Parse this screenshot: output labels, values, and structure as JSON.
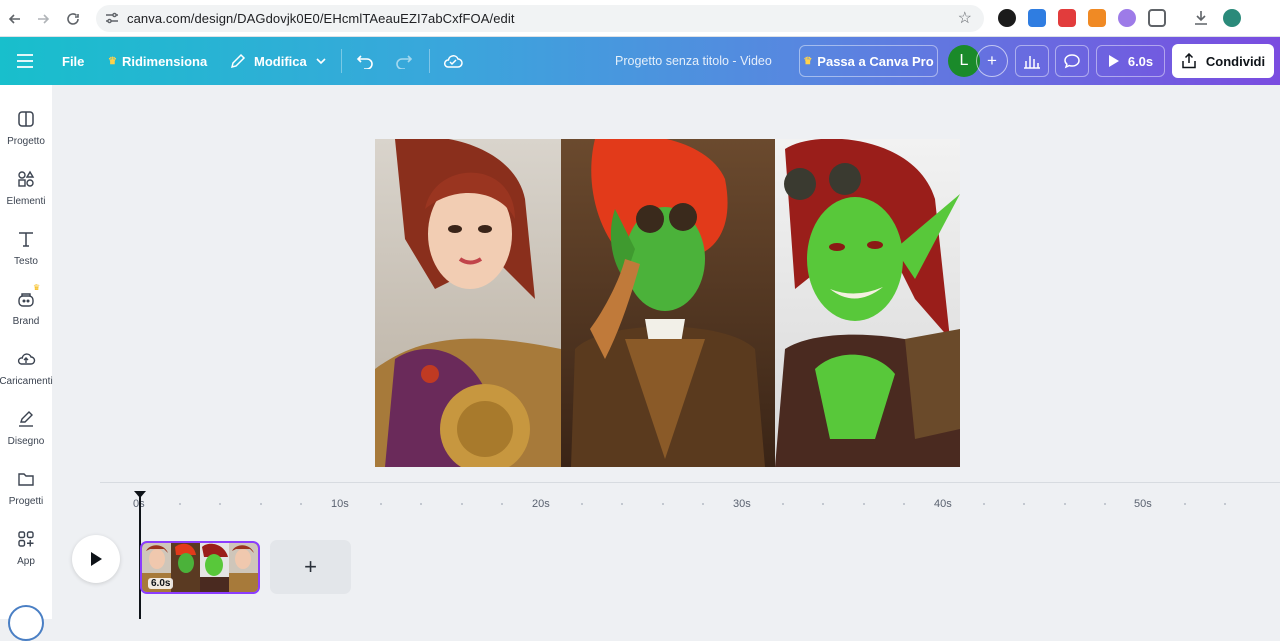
{
  "browser": {
    "url": "canva.com/design/DAGdovjk0E0/EHcmlTAeauEZI7abCxfFOA/edit",
    "back_icon": "arrow-left-icon",
    "forward_icon": "arrow-right-icon",
    "reload_icon": "reload-icon"
  },
  "toolbar": {
    "file": "File",
    "resize": "Ridimensiona",
    "edit": "Modifica",
    "project_title": "Progetto senza titolo - Video",
    "upgrade": "Passa a Canva Pro",
    "avatar_initial": "L",
    "play_duration": "6.0s",
    "share": "Condividi"
  },
  "sidebar": {
    "items": [
      {
        "label": "Progetto",
        "icon": "layout-icon"
      },
      {
        "label": "Elementi",
        "icon": "shapes-icon"
      },
      {
        "label": "Testo",
        "icon": "text-icon"
      },
      {
        "label": "Brand",
        "icon": "brand-icon"
      },
      {
        "label": "Caricamenti",
        "icon": "cloud-upload-icon"
      },
      {
        "label": "Disegno",
        "icon": "draw-icon"
      },
      {
        "label": "Progetti",
        "icon": "folder-icon"
      },
      {
        "label": "App",
        "icon": "apps-icon"
      }
    ]
  },
  "timeline": {
    "ticks": [
      "0s",
      "10s",
      "20s",
      "30s",
      "40s",
      "50s"
    ],
    "clip_duration": "6.0s",
    "add_label": "+"
  },
  "colors": {
    "accent": "#8b3dff",
    "avatar": "#1a8a2a",
    "toolbar_start": "#18bfcc",
    "toolbar_end": "#7a4ce0"
  }
}
